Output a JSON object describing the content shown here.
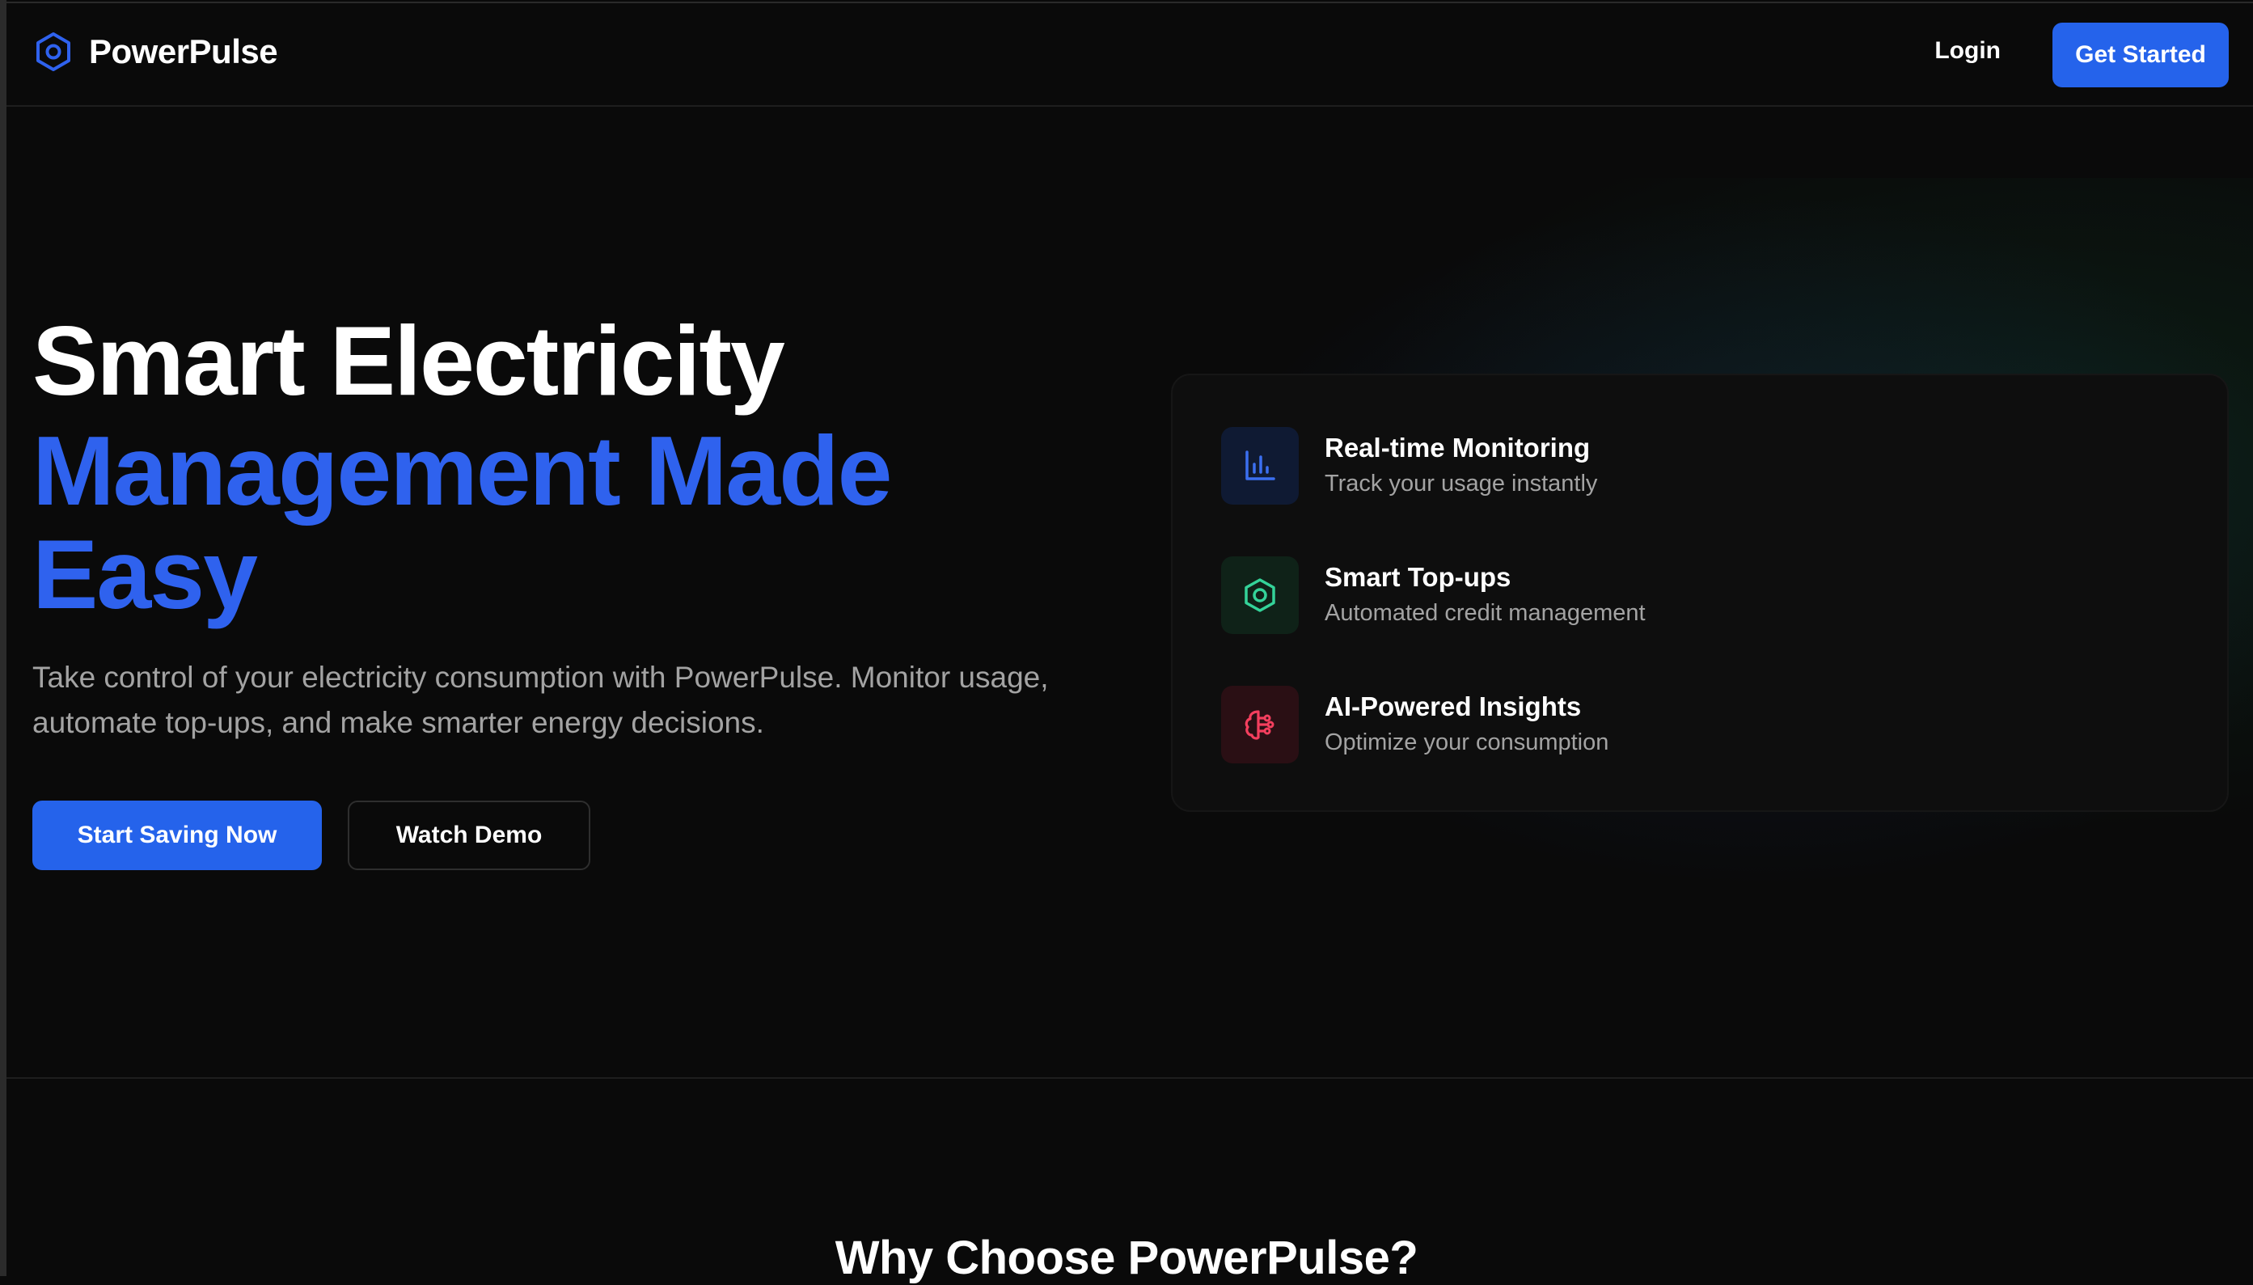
{
  "brand": {
    "name": "PowerPulse",
    "icon": "hexagon-logo-icon",
    "accent": "#2563eb"
  },
  "nav": {
    "login": "Login",
    "get_started": "Get Started"
  },
  "hero": {
    "title_line1": "Smart Electricity",
    "title_line2": "Management Made",
    "title_line3": "Easy",
    "description": "Take control of your electricity consumption with PowerPulse. Monitor usage, automate top-ups, and make smarter energy decisions.",
    "primary_cta": "Start Saving Now",
    "secondary_cta": "Watch Demo"
  },
  "features": [
    {
      "title": "Real-time Monitoring",
      "subtitle": "Track your usage instantly",
      "icon": "bar-chart-icon",
      "color": "#3b6ff0"
    },
    {
      "title": "Smart Top-ups",
      "subtitle": "Automated credit management",
      "icon": "hexagon-icon",
      "color": "#34d399"
    },
    {
      "title": "AI-Powered Insights",
      "subtitle": "Optimize your consumption",
      "icon": "brain-circuit-icon",
      "color": "#f43f5e"
    }
  ],
  "why_section": {
    "title": "Why Choose PowerPulse?"
  }
}
